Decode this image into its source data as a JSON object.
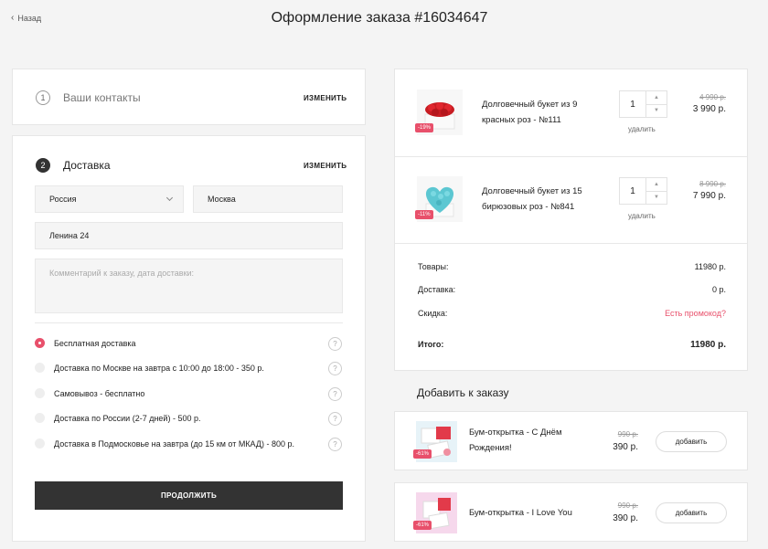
{
  "header": {
    "back_label": "Назад",
    "title": "Оформление заказа #16034647"
  },
  "contacts": {
    "step": "1",
    "label": "Ваши контакты",
    "edit": "ИЗМЕНИТЬ"
  },
  "delivery": {
    "step": "2",
    "label": "Доставка",
    "edit": "ИЗМЕНИТЬ",
    "country": "Россия",
    "city": "Москва",
    "address": "Ленина 24",
    "comment_placeholder": "Комментарий к заказу, дата доставки:",
    "options": [
      {
        "label": "Бесплатная доставка",
        "selected": true
      },
      {
        "label": "Доставка по Москве на завтра с 10:00 до 18:00 - 350 р.",
        "selected": false
      },
      {
        "label": "Самовывоз - бесплатно",
        "selected": false
      },
      {
        "label": "Доставка по России (2-7 дней) - 500 р.",
        "selected": false
      },
      {
        "label": "Доставка в Подмосковье на завтра (до 15 км от МКАД) - 800 р.",
        "selected": false
      }
    ],
    "help_glyph": "?",
    "continue_label": "ПРОДОЛЖИТЬ"
  },
  "cart": {
    "items": [
      {
        "name_line1": "Долговечный букет из 9",
        "name_line2": "красных роз - №111",
        "badge": "-19%",
        "qty": "1",
        "remove": "удалить",
        "old_price": "4 990 р.",
        "price": "3 990 р."
      },
      {
        "name_line1": "Долговечный букет из 15",
        "name_line2": "бирюзовых роз - №841",
        "badge": "-11%",
        "qty": "1",
        "remove": "удалить",
        "old_price": "8 990 р.",
        "price": "7 990 р."
      }
    ],
    "summary": {
      "goods_label": "Товары:",
      "goods_value": "11980 р.",
      "delivery_label": "Доставка:",
      "delivery_value": "0 р.",
      "discount_label": "Скидка:",
      "promo_link": "Есть промокод?",
      "total_label": "Итого:",
      "total_value": "11980 р."
    }
  },
  "addons": {
    "title": "Добавить к заказу",
    "items": [
      {
        "name_line1": "Бум-открытка - С Днём",
        "name_line2": "Рождения!",
        "badge": "-61%",
        "old_price": "990 р.",
        "price": "390 р.",
        "button": "добавить"
      },
      {
        "name_line1": "Бум-открытка - I Love You",
        "name_line2": "",
        "badge": "-61%",
        "old_price": "990 р.",
        "price": "390 р.",
        "button": "добавить"
      }
    ]
  },
  "colors": {
    "accent": "#e8506b",
    "dark_button": "#333333",
    "background": "#f4f4f4"
  }
}
